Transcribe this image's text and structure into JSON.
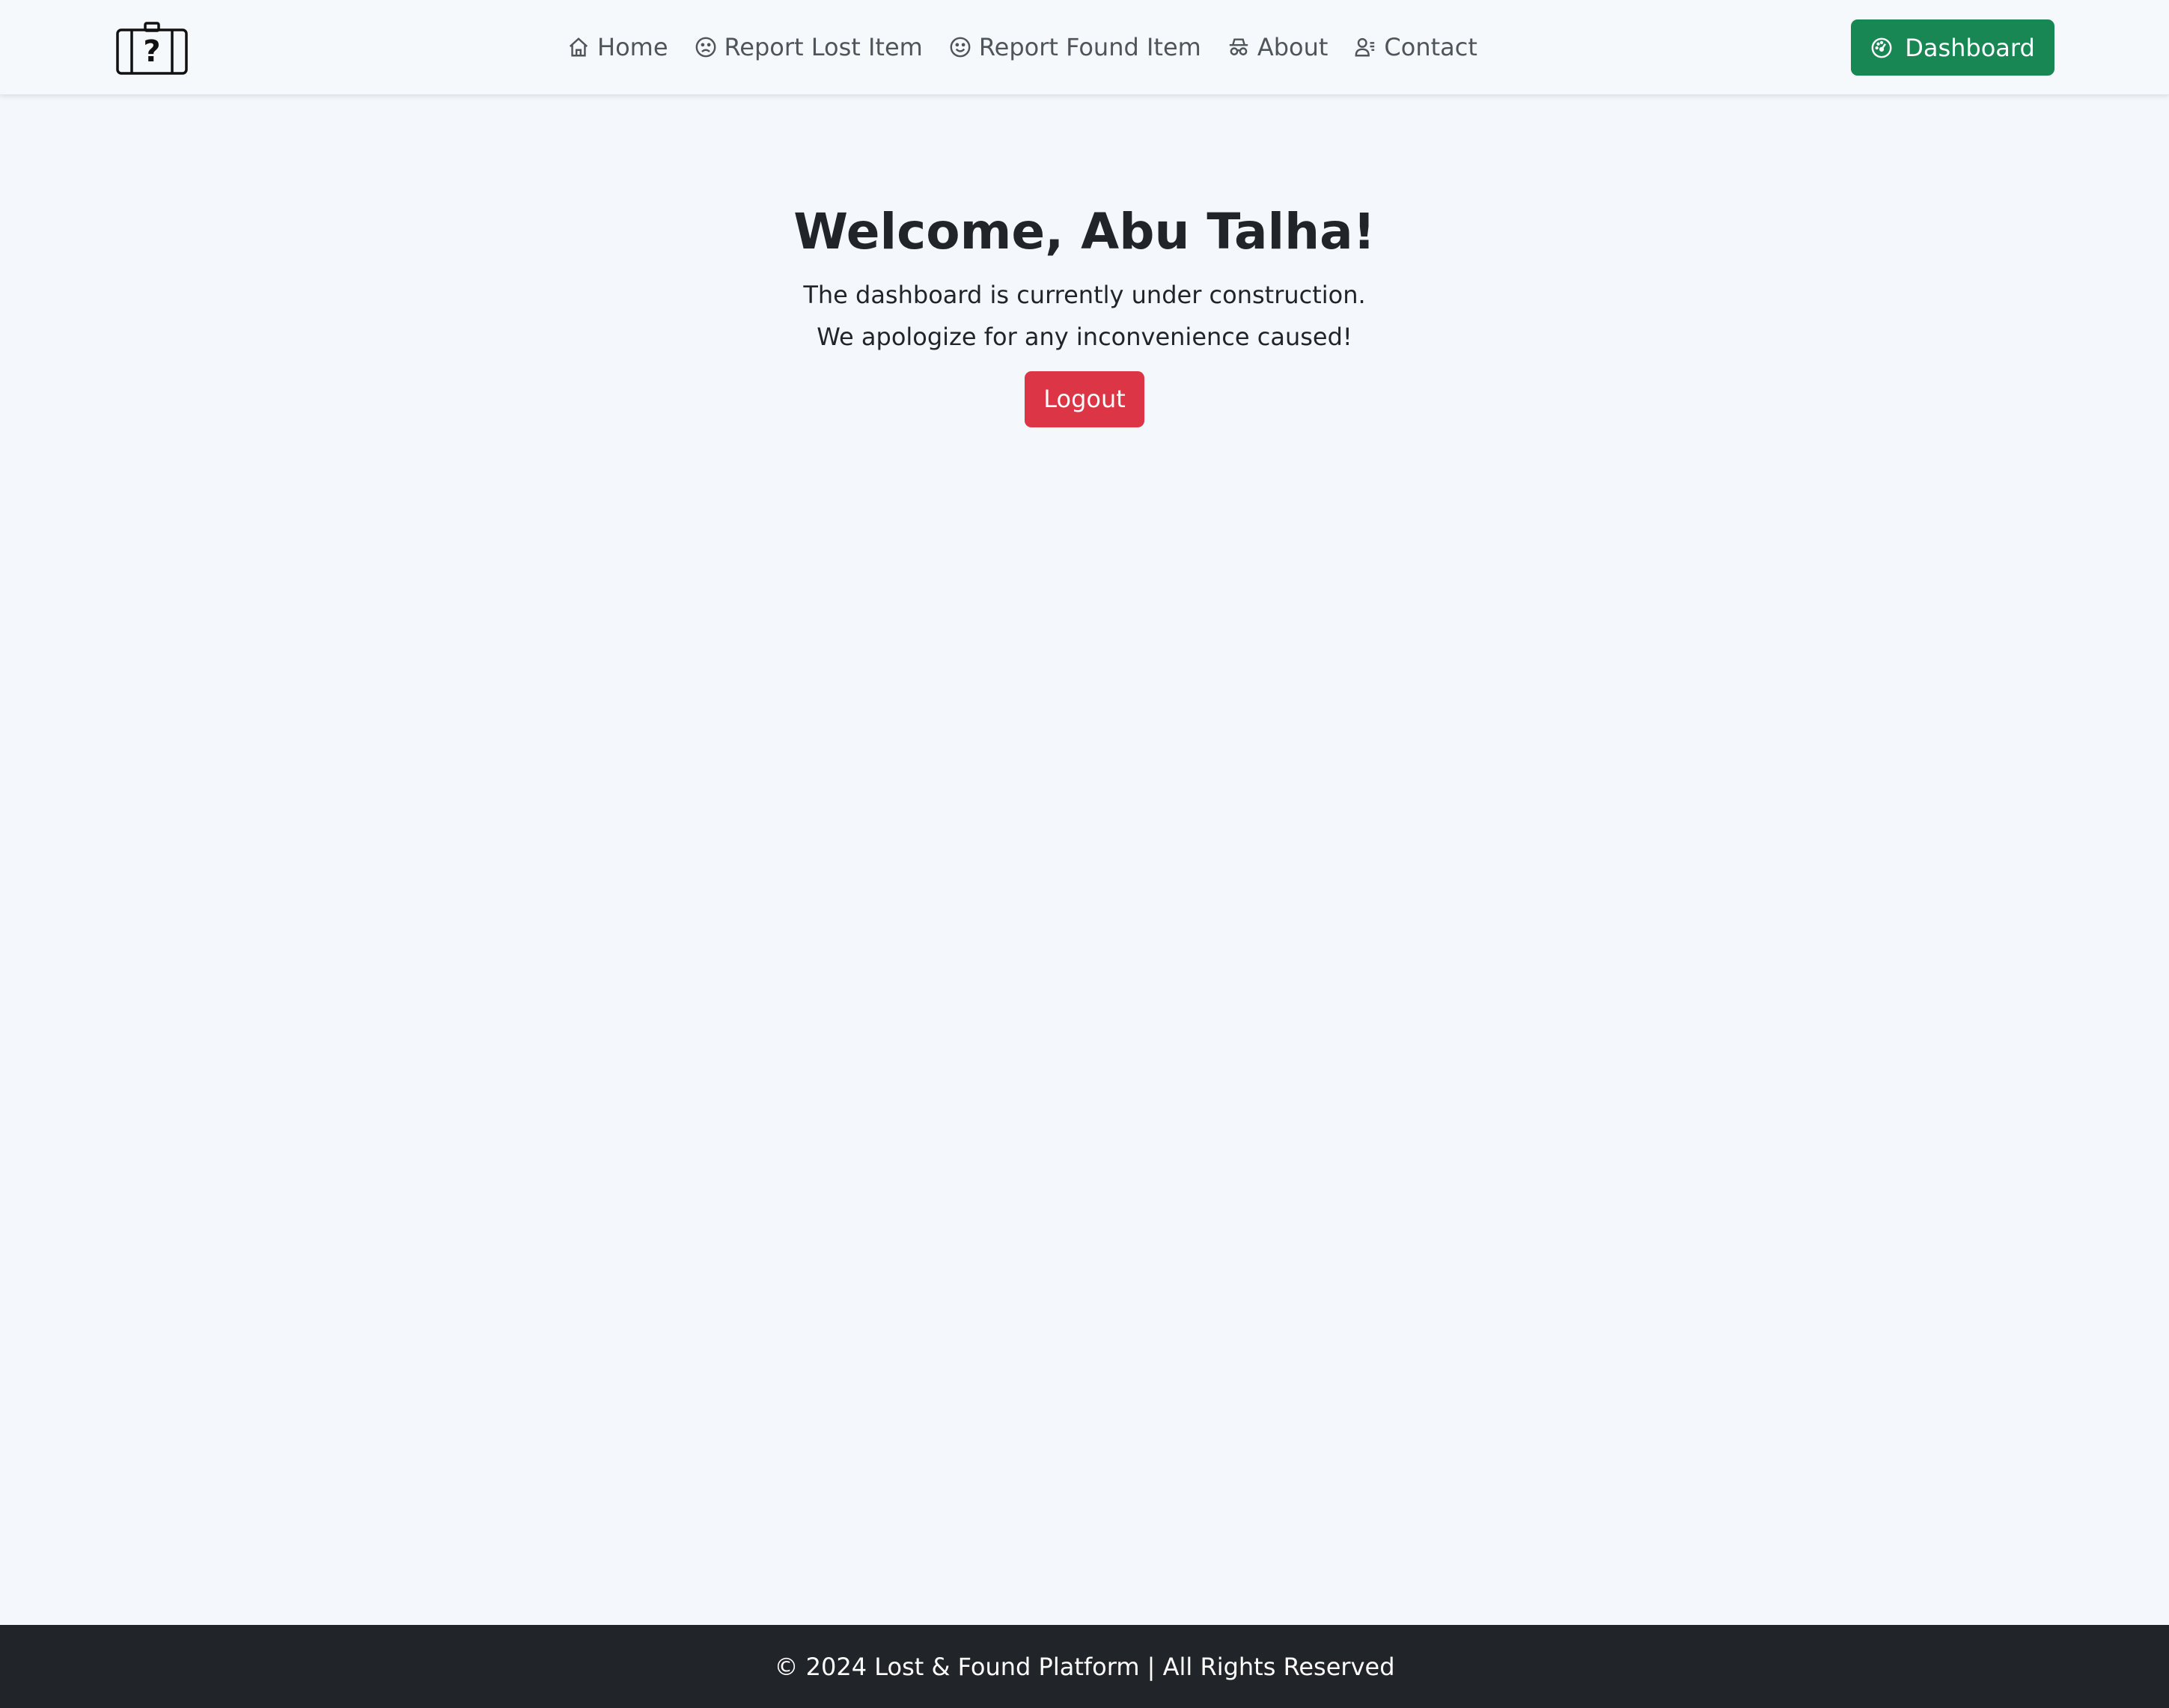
{
  "header": {
    "logo_icon": "suitcase-question-icon",
    "nav": [
      {
        "label": "Home",
        "icon": "home-icon"
      },
      {
        "label": "Report Lost Item",
        "icon": "sad-face-icon"
      },
      {
        "label": "Report Found Item",
        "icon": "smile-face-icon"
      },
      {
        "label": "About",
        "icon": "incognito-icon"
      },
      {
        "label": "Contact",
        "icon": "person-lines-icon"
      }
    ],
    "dashboard_button": {
      "label": "Dashboard",
      "icon": "speedometer-icon",
      "color": "#198754"
    }
  },
  "main": {
    "welcome": "Welcome, Abu Talha!",
    "line1": "The dashboard is currently under construction.",
    "line2": "We apologize for any inconvenience caused!",
    "logout_label": "Logout",
    "logout_color": "#dc3545"
  },
  "footer": {
    "text": "© 2024 Lost & Found Platform | All Rights Reserved"
  }
}
